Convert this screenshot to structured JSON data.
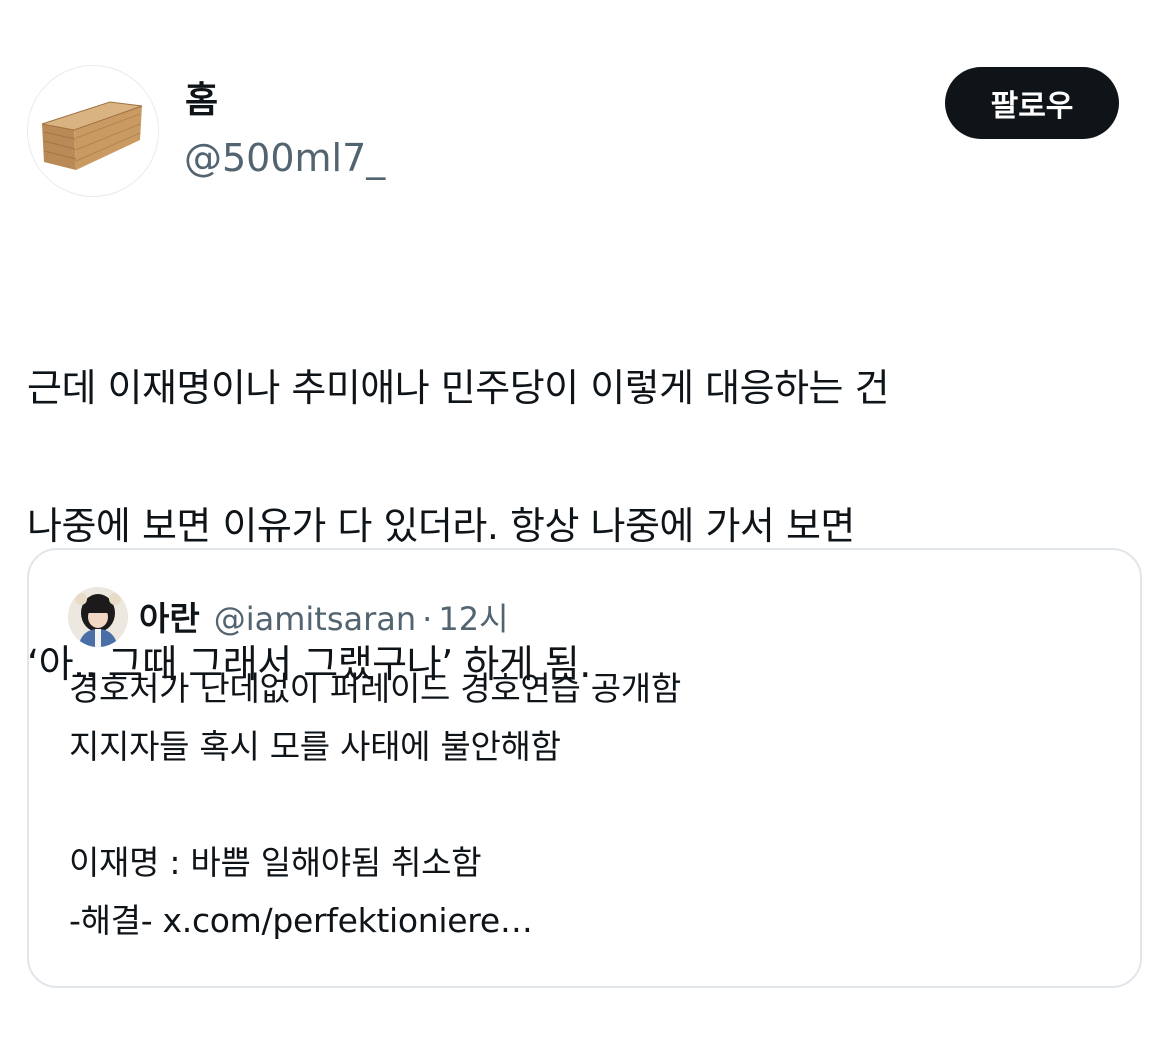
{
  "author": {
    "display_name": "홈",
    "handle": "@500ml7_",
    "avatar_icon": "wooden-coffin-icon"
  },
  "follow_button": {
    "label": "팔로우"
  },
  "tweet": {
    "lines": [
      "근데 이재명이나 추미애나 민주당이 이렇게 대응하는 건",
      "나중에 보면 이유가 다 있더라. 항상 나중에 가서 보면",
      "‘아.. 그때 그래서 그랬구나’ 하게 됨."
    ]
  },
  "quoted_tweet": {
    "display_name": "아란",
    "handle": "@iamitsaran",
    "separator": "·",
    "time": "12시",
    "avatar_icon": "profile-photo-icon",
    "lines": [
      "경호처가 난데없이 퍼레이드 경호연습 공개함",
      "지지자들 혹시 모를 사태에 불안해함",
      "",
      "이재명 : 바쁨 일해야됨 취소함",
      "-해결- x.com/perfektioniere…"
    ]
  },
  "colors": {
    "text_primary": "#0f1419",
    "text_secondary": "#536471",
    "button_bg": "#0f1419",
    "button_text": "#ffffff",
    "card_border": "#e1e6ea"
  }
}
